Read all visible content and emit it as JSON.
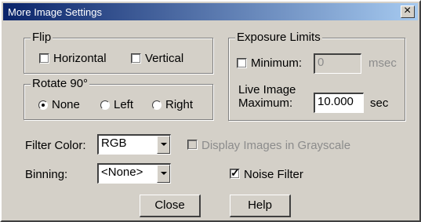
{
  "window": {
    "title": "More Image Settings"
  },
  "flip": {
    "legend": "Flip",
    "horizontal": {
      "label": "Horizontal",
      "checked": false
    },
    "vertical": {
      "label": "Vertical",
      "checked": false
    }
  },
  "rotate": {
    "legend": "Rotate 90°",
    "options": [
      {
        "label": "None",
        "selected": true
      },
      {
        "label": "Left",
        "selected": false
      },
      {
        "label": "Right",
        "selected": false
      }
    ]
  },
  "exposure": {
    "legend": "Exposure Limits",
    "minimum": {
      "label": "Minimum:",
      "checked": false,
      "value": "0",
      "unit": "msec"
    },
    "live_max": {
      "label_line1": "Live Image",
      "label_line2": "Maximum:",
      "value": "10.000",
      "unit": "sec"
    }
  },
  "filter_color": {
    "label": "Filter Color:",
    "value": "RGB"
  },
  "grayscale": {
    "label": "Display Images in Grayscale",
    "checked": false,
    "enabled": false
  },
  "binning": {
    "label": "Binning:",
    "value": "<None>"
  },
  "noise_filter": {
    "label": "Noise Filter",
    "checked": true
  },
  "buttons": {
    "close": "Close",
    "help": "Help"
  }
}
